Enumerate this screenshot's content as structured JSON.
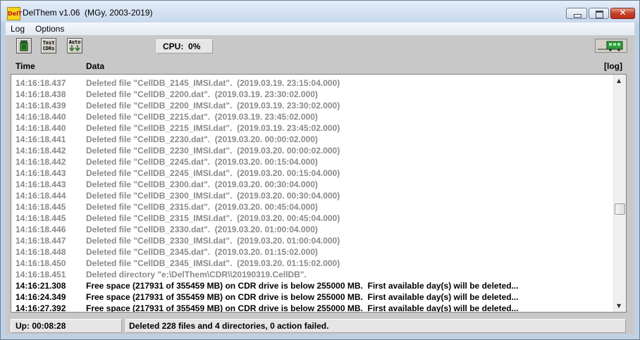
{
  "window": {
    "title": "DelThem v1.06  (MGy, 2003-2019)",
    "icon_text": "DelT"
  },
  "menu": [
    "Log",
    "Options"
  ],
  "toolbar": {
    "tools": [
      {
        "name": "trash-tool",
        "label": ""
      },
      {
        "name": "test-cdr-tool",
        "label": "Test\nCDRs"
      },
      {
        "name": "auto-tool",
        "label": "Auto"
      }
    ],
    "cpu_label": "CPU:",
    "cpu_value": "0%"
  },
  "columns": {
    "time": "Time",
    "data": "Data",
    "log": "[log]"
  },
  "log_rows": [
    {
      "time": "14:16:18.437",
      "data": "Deleted file \"CellDB_2145_IMSI.dat\".  (2019.03.19. 23:15:04.000)",
      "style": "grey"
    },
    {
      "time": "14:16:18.438",
      "data": "Deleted file \"CellDB_2200.dat\".  (2019.03.19. 23:30:02.000)",
      "style": "grey"
    },
    {
      "time": "14:16:18.439",
      "data": "Deleted file \"CellDB_2200_IMSI.dat\".  (2019.03.19. 23:30:02.000)",
      "style": "grey"
    },
    {
      "time": "14:16:18.440",
      "data": "Deleted file \"CellDB_2215.dat\".  (2019.03.19. 23:45:02.000)",
      "style": "grey"
    },
    {
      "time": "14:16:18.440",
      "data": "Deleted file \"CellDB_2215_IMSI.dat\".  (2019.03.19. 23:45:02.000)",
      "style": "grey"
    },
    {
      "time": "14:16:18.441",
      "data": "Deleted file \"CellDB_2230.dat\".  (2019.03.20. 00:00:02.000)",
      "style": "grey"
    },
    {
      "time": "14:16:18.442",
      "data": "Deleted file \"CellDB_2230_IMSI.dat\".  (2019.03.20. 00:00:02.000)",
      "style": "grey"
    },
    {
      "time": "14:16:18.442",
      "data": "Deleted file \"CellDB_2245.dat\".  (2019.03.20. 00:15:04.000)",
      "style": "grey"
    },
    {
      "time": "14:16:18.443",
      "data": "Deleted file \"CellDB_2245_IMSI.dat\".  (2019.03.20. 00:15:04.000)",
      "style": "grey"
    },
    {
      "time": "14:16:18.443",
      "data": "Deleted file \"CellDB_2300.dat\".  (2019.03.20. 00:30:04.000)",
      "style": "grey"
    },
    {
      "time": "14:16:18.444",
      "data": "Deleted file \"CellDB_2300_IMSI.dat\".  (2019.03.20. 00:30:04.000)",
      "style": "grey"
    },
    {
      "time": "14:16:18.445",
      "data": "Deleted file \"CellDB_2315.dat\".  (2019.03.20. 00:45:04.000)",
      "style": "grey"
    },
    {
      "time": "14:16:18.445",
      "data": "Deleted file \"CellDB_2315_IMSI.dat\".  (2019.03.20. 00:45:04.000)",
      "style": "grey"
    },
    {
      "time": "14:16:18.446",
      "data": "Deleted file \"CellDB_2330.dat\".  (2019.03.20. 01:00:04.000)",
      "style": "grey"
    },
    {
      "time": "14:16:18.447",
      "data": "Deleted file \"CellDB_2330_IMSI.dat\".  (2019.03.20. 01:00:04.000)",
      "style": "grey"
    },
    {
      "time": "14:16:18.448",
      "data": "Deleted file \"CellDB_2345.dat\".  (2019.03.20. 01:15:02.000)",
      "style": "grey"
    },
    {
      "time": "14:16:18.450",
      "data": "Deleted file \"CellDB_2345_IMSI.dat\".  (2019.03.20. 01:15:02.000)",
      "style": "grey"
    },
    {
      "time": "14:16:18.451",
      "data": "Deleted directory \"e:\\DelThem\\CDR\\\\20190319.CellDB\".",
      "style": "grey"
    },
    {
      "time": "14:16:21.308",
      "data": "Free space (217931 of 355459 MB) on CDR drive is below 255000 MB.  First available day(s) will be deleted...",
      "style": "black"
    },
    {
      "time": "14:16:24.349",
      "data": "Free space (217931 of 355459 MB) on CDR drive is below 255000 MB.  First available day(s) will be deleted...",
      "style": "black"
    },
    {
      "time": "14:16:27.392",
      "data": "Free space (217931 of 355459 MB) on CDR drive is below 255000 MB.  First available day(s) will be deleted...",
      "style": "black"
    }
  ],
  "status": {
    "uptime": "Up: 00:08:28",
    "message": "Deleted 228 files and 4 directories, 0 action failed."
  },
  "colors": {
    "grey_text": "#8a8a8a",
    "black_text": "#000000",
    "close_button": "#c3412b"
  }
}
